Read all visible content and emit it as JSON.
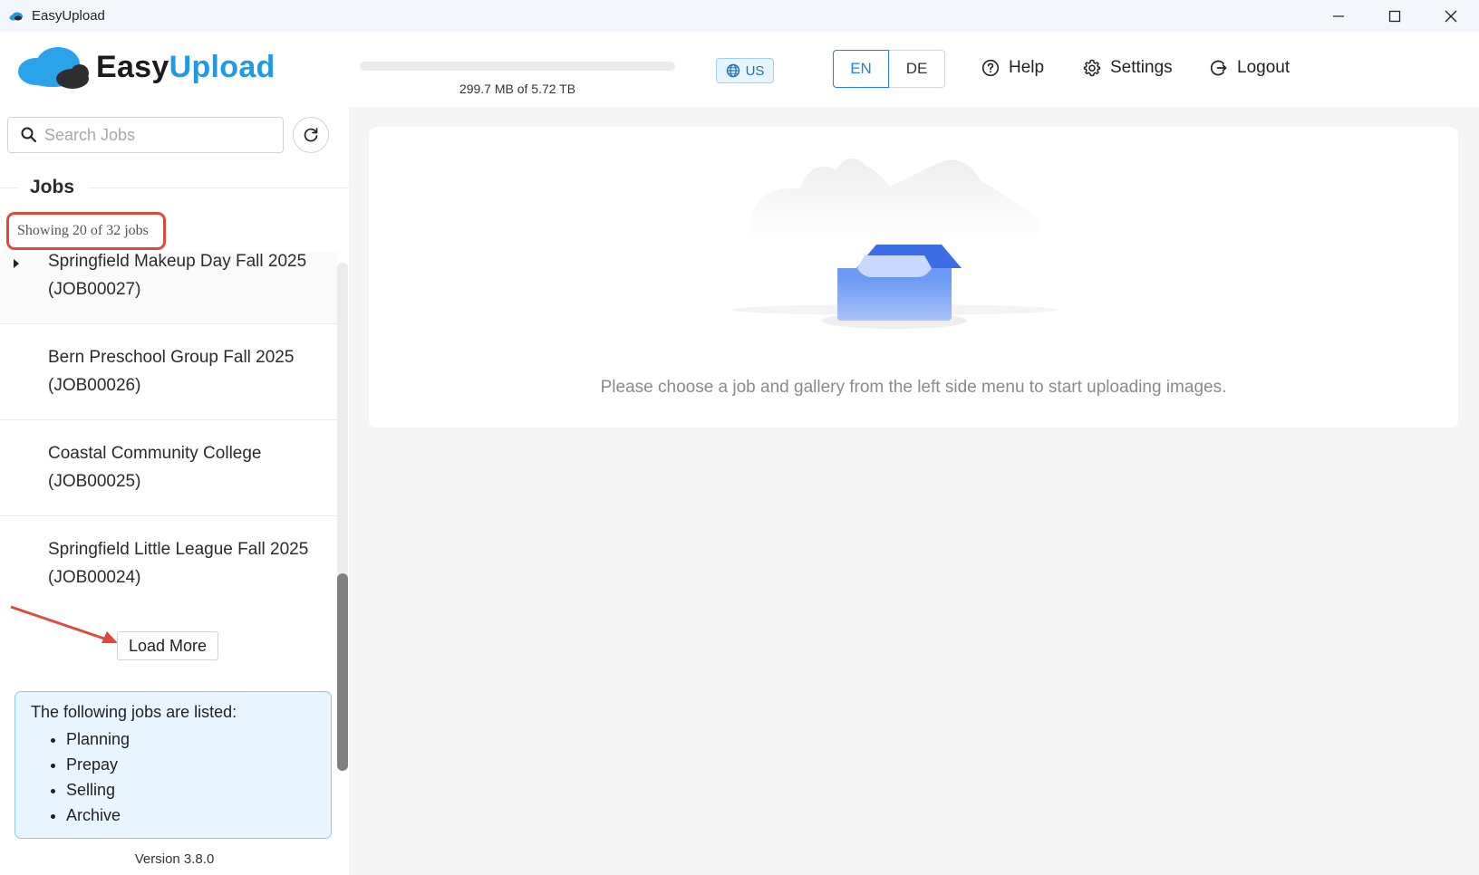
{
  "window": {
    "title": "EasyUpload"
  },
  "header": {
    "logo_easy": "Easy",
    "logo_upload": "Upload",
    "storage_text": "299.7 MB of 5.72 TB",
    "storage_used_fraction": 0.0001,
    "region": "US",
    "lang_en": "EN",
    "lang_de": "DE",
    "help_label": "Help",
    "settings_label": "Settings",
    "logout_label": "Logout"
  },
  "sidebar": {
    "search_placeholder": "Search Jobs",
    "jobs_heading": "Jobs",
    "showing_text": "Showing 20 of 32 jobs",
    "jobs": [
      {
        "name": "Springfield Makeup Day Fall 2025",
        "id": "(JOB00027)"
      },
      {
        "name": "Bern Preschool Group Fall 2025",
        "id": "(JOB00026)"
      },
      {
        "name": "Coastal Community College",
        "id": "(JOB00025)"
      },
      {
        "name": "Springfield Little League Fall 2025",
        "id": "(JOB00024)"
      }
    ],
    "load_more_label": "Load More",
    "info_title": "The following jobs are listed:",
    "info_items": [
      "Planning",
      "Prepay",
      "Selling",
      "Archive"
    ],
    "version": "Version 3.8.0"
  },
  "main": {
    "empty_text": "Please choose a job and gallery from the left side menu to start uploading images."
  },
  "colors": {
    "accent": "#1e9be6",
    "annotation": "#de4a3a"
  }
}
